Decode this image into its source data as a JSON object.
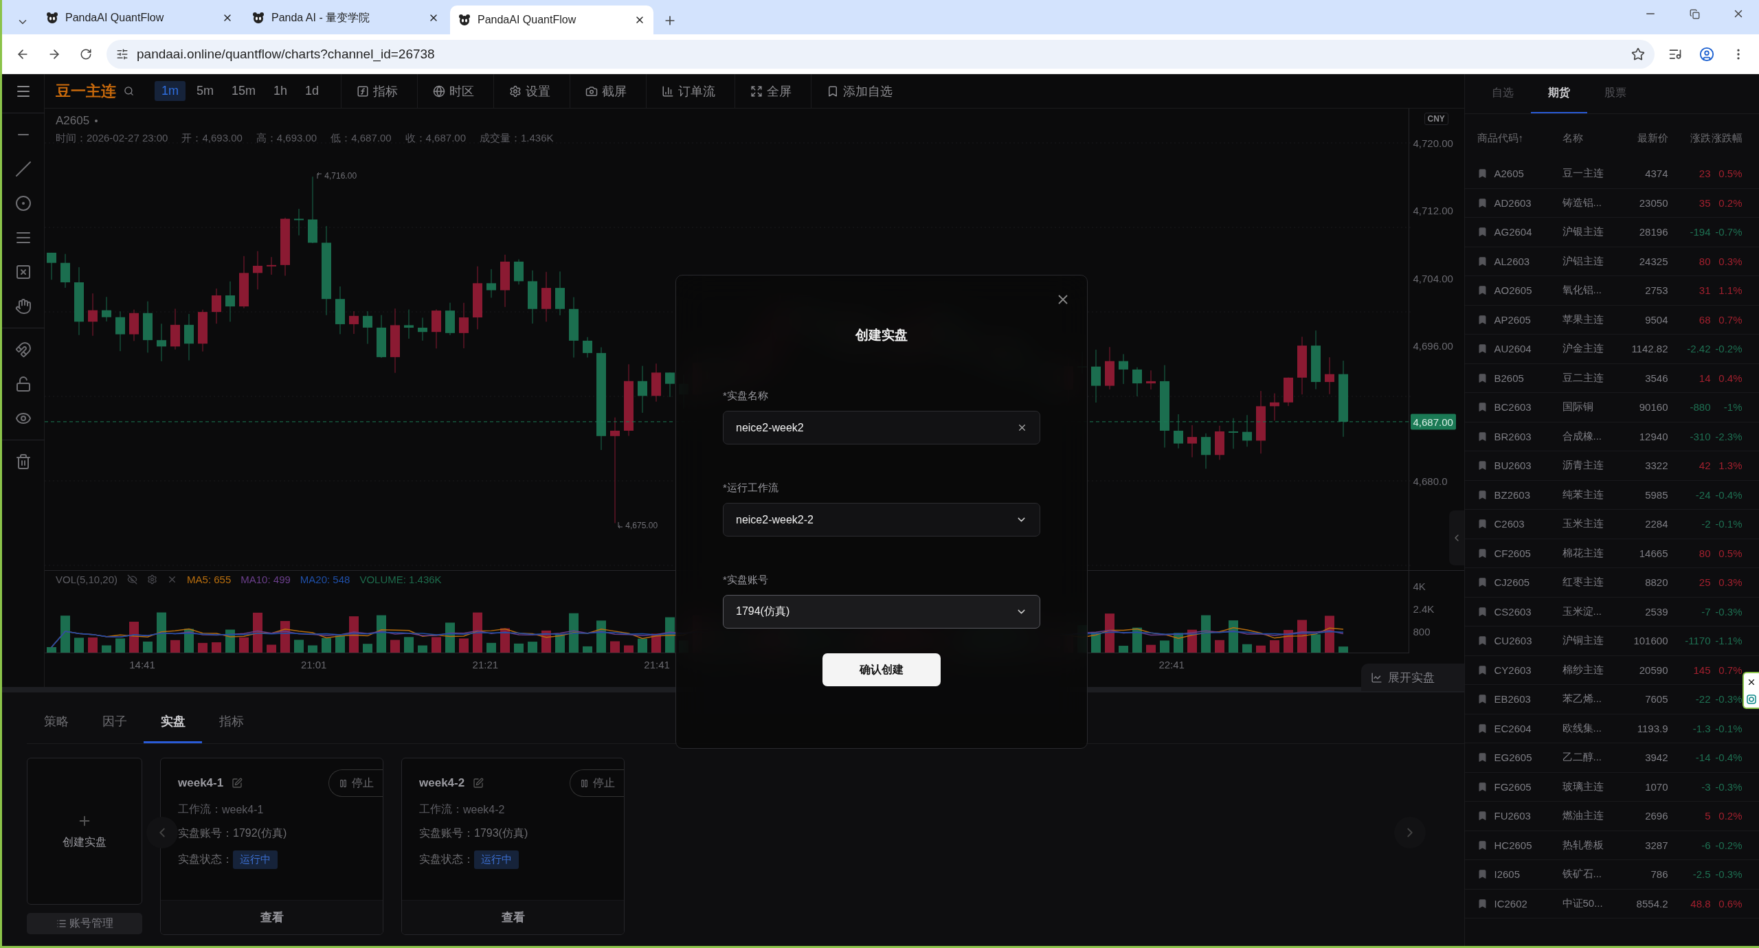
{
  "browser": {
    "tabs": [
      {
        "title": "PandaAI QuantFlow",
        "selected": false
      },
      {
        "title": "Panda AI - 量变学院",
        "selected": false
      },
      {
        "title": "PandaAI QuantFlow",
        "selected": true
      }
    ],
    "url": "pandaai.online/quantflow/charts?channel_id=26738"
  },
  "toolbar": {
    "symbol": "豆一主连",
    "intervals": [
      {
        "label": "1m",
        "selected": true
      },
      {
        "label": "5m",
        "selected": false
      },
      {
        "label": "15m",
        "selected": false
      },
      {
        "label": "1h",
        "selected": false
      },
      {
        "label": "1d",
        "selected": false
      }
    ],
    "tools": [
      {
        "kind": "indicator",
        "label": "指标"
      },
      {
        "kind": "timezone",
        "label": "时区"
      },
      {
        "kind": "settings",
        "label": "设置"
      },
      {
        "kind": "screenshot",
        "label": "截屏"
      },
      {
        "kind": "orderflow",
        "label": "订单流"
      },
      {
        "kind": "fullscreen",
        "label": "全屏"
      },
      {
        "kind": "watchlist",
        "label": "添加自选"
      }
    ]
  },
  "chart": {
    "symbol": "A2605",
    "info": [
      "时间：2026-02-27 23:00",
      "开：4,693.00",
      "高：4,693.00",
      "低：4,687.00",
      "收：4,687.00",
      "成交量：1.436K"
    ],
    "high_marker": "4,716.00",
    "low_marker": "4,675.00",
    "currency": "CNY",
    "price_axis": [
      "4,720.00",
      "4,712.00",
      "4,704.00",
      "4,696.00",
      "4,680.0"
    ],
    "last_price": "4,687.00",
    "volume_legend": {
      "title": "VOL(5,10,20)",
      "items": [
        {
          "text": "MA5: 655",
          "color": "#b86e0e"
        },
        {
          "text": "MA10: 499",
          "color": "#6b3f8c"
        },
        {
          "text": "MA20: 548",
          "color": "#1f4fa8"
        },
        {
          "text": "VOLUME: 1.436K",
          "color": "#1d6b4c"
        }
      ]
    },
    "volume_axis": [
      "4K",
      "2.4K",
      "800"
    ],
    "time_axis": [
      "14:41",
      "21:01",
      "21:21",
      "21:41",
      "22:41"
    ],
    "expand_button": "展开实盘"
  },
  "bottom_panel": {
    "tabs": [
      {
        "label": "策略",
        "selected": false
      },
      {
        "label": "因子",
        "selected": false
      },
      {
        "label": "实盘",
        "selected": true
      },
      {
        "label": "指标",
        "selected": false
      }
    ],
    "create_label": "创建实盘",
    "account_button": "账号管理",
    "cards": [
      {
        "name": "week4-1",
        "stop_button": "停止",
        "workflow_label": "工作流：",
        "workflow": "week4-1",
        "account_label": "实盘账号：",
        "account": "1792(仿真)",
        "status_label": "实盘状态：",
        "status": "运行中",
        "view_button": "查看"
      },
      {
        "name": "week4-2",
        "stop_button": "停止",
        "workflow_label": "工作流：",
        "workflow": "week4-2",
        "account_label": "实盘账号：",
        "account": "1793(仿真)",
        "status_label": "实盘状态：",
        "status": "运行中",
        "view_button": "查看"
      }
    ]
  },
  "market_panel": {
    "tabs": [
      {
        "label": "自选",
        "selected": false
      },
      {
        "label": "期货",
        "selected": true
      },
      {
        "label": "股票",
        "selected": false
      }
    ],
    "columns": [
      "商品代码↑",
      "名称",
      "最新价",
      "涨跌",
      "涨跌幅"
    ],
    "rows": [
      {
        "code": "A2605",
        "name": "豆一主连",
        "price": "4374",
        "change": "23",
        "pct": "0.5%",
        "rising": true
      },
      {
        "code": "AD2603",
        "name": "铸造铝...",
        "price": "23050",
        "change": "35",
        "pct": "0.2%",
        "rising": true
      },
      {
        "code": "AG2604",
        "name": "沪银主连",
        "price": "28196",
        "change": "-194",
        "pct": "-0.7%",
        "rising": false
      },
      {
        "code": "AL2603",
        "name": "沪铝主连",
        "price": "24325",
        "change": "80",
        "pct": "0.3%",
        "rising": true
      },
      {
        "code": "AO2605",
        "name": "氧化铝...",
        "price": "2753",
        "change": "31",
        "pct": "1.1%",
        "rising": true
      },
      {
        "code": "AP2605",
        "name": "苹果主连",
        "price": "9504",
        "change": "68",
        "pct": "0.7%",
        "rising": true
      },
      {
        "code": "AU2604",
        "name": "沪金主连",
        "price": "1142.82",
        "change": "-2.42",
        "pct": "-0.2%",
        "rising": false
      },
      {
        "code": "B2605",
        "name": "豆二主连",
        "price": "3546",
        "change": "14",
        "pct": "0.4%",
        "rising": true
      },
      {
        "code": "BC2603",
        "name": "国际铜",
        "price": "90160",
        "change": "-880",
        "pct": "-1%",
        "rising": false
      },
      {
        "code": "BR2603",
        "name": "合成橡...",
        "price": "12940",
        "change": "-310",
        "pct": "-2.3%",
        "rising": false
      },
      {
        "code": "BU2603",
        "name": "沥青主连",
        "price": "3322",
        "change": "42",
        "pct": "1.3%",
        "rising": true
      },
      {
        "code": "BZ2603",
        "name": "纯苯主连",
        "price": "5985",
        "change": "-24",
        "pct": "-0.4%",
        "rising": false
      },
      {
        "code": "C2603",
        "name": "玉米主连",
        "price": "2284",
        "change": "-2",
        "pct": "-0.1%",
        "rising": false
      },
      {
        "code": "CF2605",
        "name": "棉花主连",
        "price": "14665",
        "change": "80",
        "pct": "0.5%",
        "rising": true
      },
      {
        "code": "CJ2605",
        "name": "红枣主连",
        "price": "8820",
        "change": "25",
        "pct": "0.3%",
        "rising": true
      },
      {
        "code": "CS2603",
        "name": "玉米淀...",
        "price": "2539",
        "change": "-7",
        "pct": "-0.3%",
        "rising": false
      },
      {
        "code": "CU2603",
        "name": "沪铜主连",
        "price": "101600",
        "change": "-1170",
        "pct": "-1.1%",
        "rising": false
      },
      {
        "code": "CY2603",
        "name": "棉纱主连",
        "price": "20590",
        "change": "145",
        "pct": "0.7%",
        "rising": true
      },
      {
        "code": "EB2603",
        "name": "苯乙烯...",
        "price": "7605",
        "change": "-22",
        "pct": "-0.3%",
        "rising": false
      },
      {
        "code": "EC2604",
        "name": "欧线集...",
        "price": "1193.9",
        "change": "-1.3",
        "pct": "-0.1%",
        "rising": false
      },
      {
        "code": "EG2605",
        "name": "乙二醇...",
        "price": "3942",
        "change": "-14",
        "pct": "-0.4%",
        "rising": false
      },
      {
        "code": "FG2605",
        "name": "玻璃主连",
        "price": "1070",
        "change": "-3",
        "pct": "-0.3%",
        "rising": false
      },
      {
        "code": "FU2603",
        "name": "燃油主连",
        "price": "2696",
        "change": "5",
        "pct": "0.2%",
        "rising": true
      },
      {
        "code": "HC2605",
        "name": "热轧卷板",
        "price": "3287",
        "change": "-6",
        "pct": "-0.2%",
        "rising": false
      },
      {
        "code": "I2605",
        "name": "铁矿石...",
        "price": "786",
        "change": "-2.5",
        "pct": "-0.3%",
        "rising": false
      },
      {
        "code": "IC2602",
        "name": "中证50...",
        "price": "8554.2",
        "change": "48.8",
        "pct": "0.6%",
        "rising": true
      }
    ]
  },
  "dialog": {
    "title": "创建实盘",
    "fields": [
      {
        "kind": "input",
        "label": "*实盘名称",
        "value": "neice2-week2",
        "focused": false
      },
      {
        "kind": "select",
        "label": "*运行工作流",
        "value": "neice2-week2-2",
        "focused": false
      },
      {
        "kind": "select",
        "label": "*实盘账号",
        "value": "1794(仿真)",
        "focused": true
      }
    ],
    "confirm_button": "确认创建"
  }
}
